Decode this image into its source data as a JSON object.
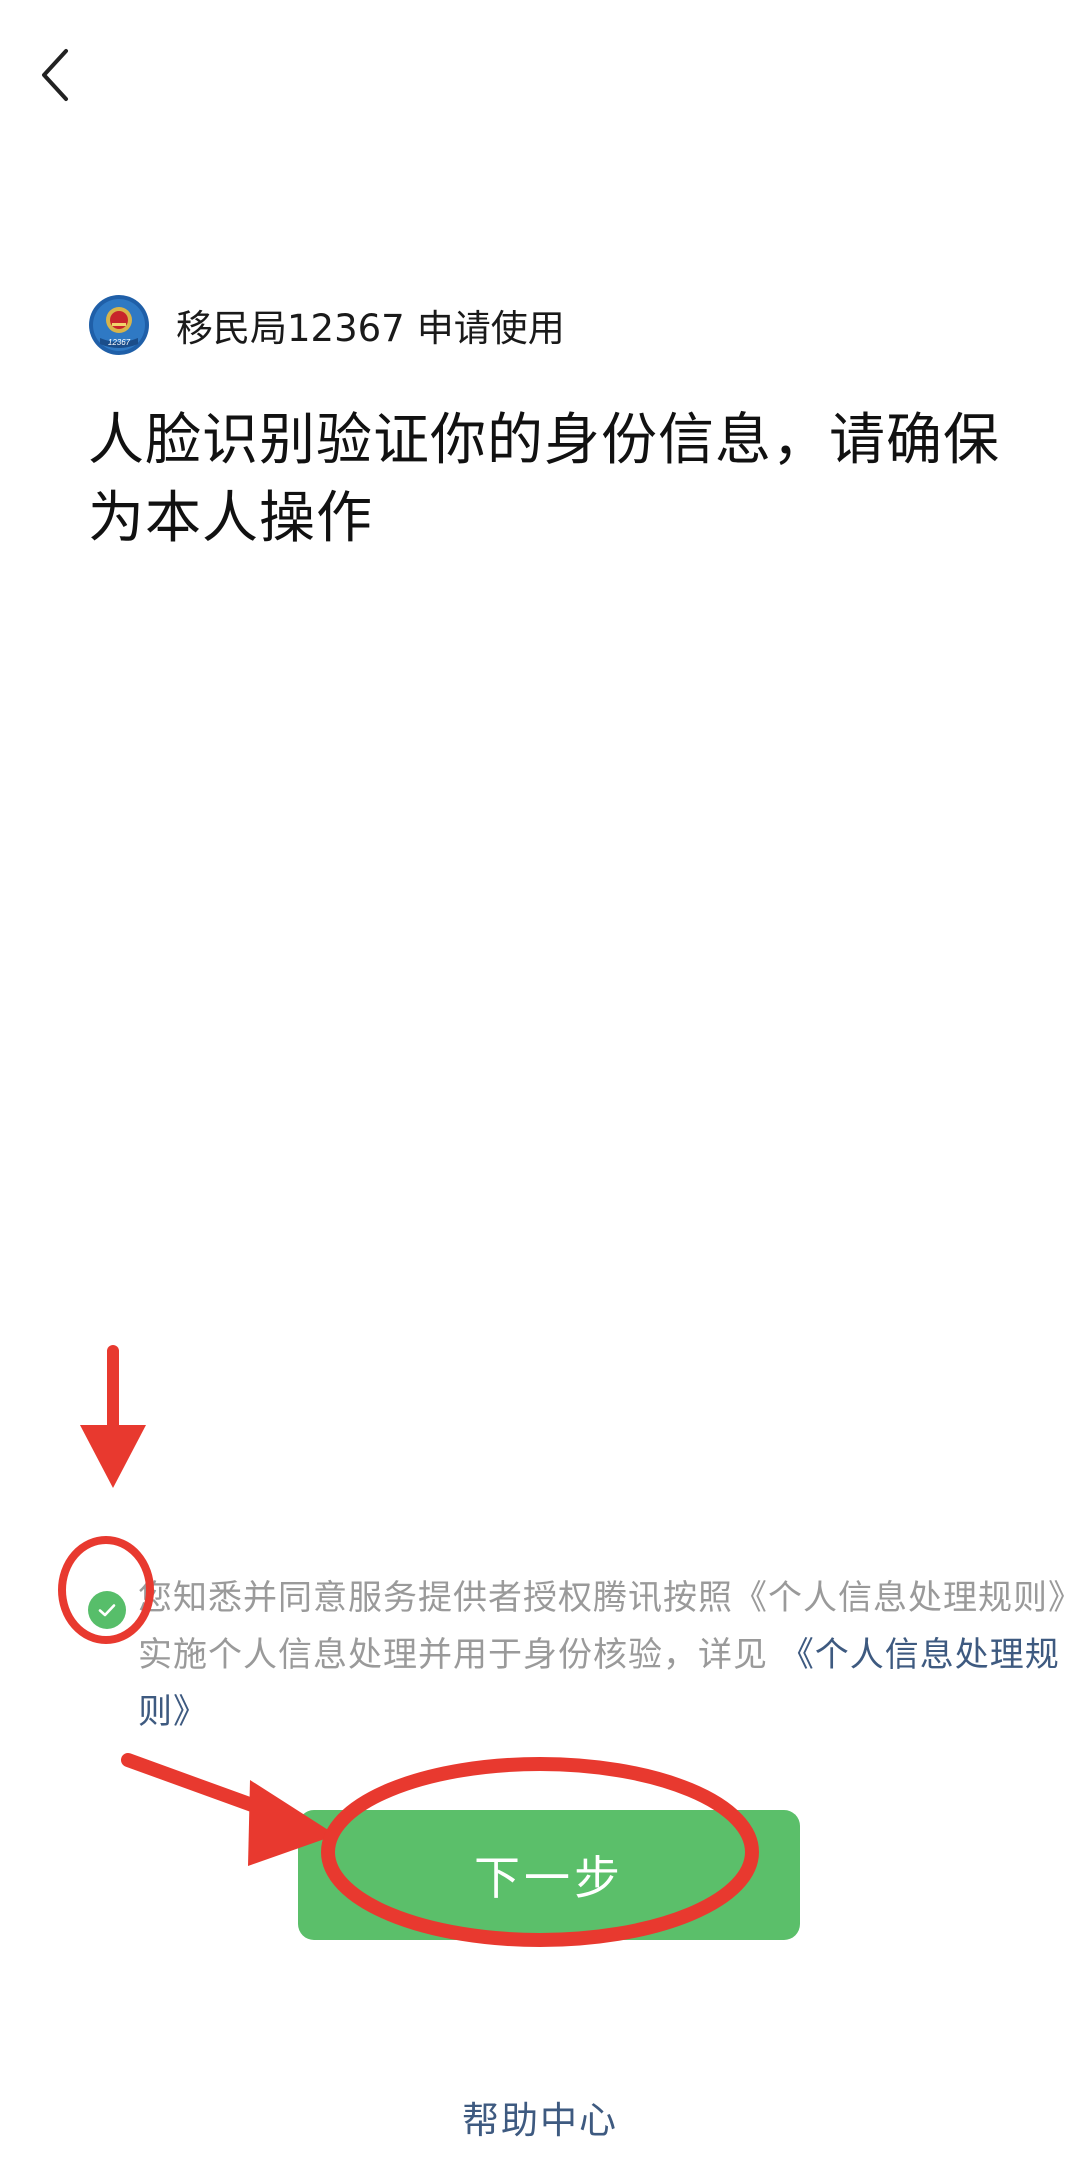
{
  "nav": {
    "back_icon": "chevron-left-icon"
  },
  "app": {
    "name": "移民局12367",
    "request_text": "申请使用",
    "logo_icon": "immigration-emblem-icon",
    "logo_text": "12367"
  },
  "headline": "人脸识别验证你的身份信息，请确保为本人操作",
  "consent": {
    "checked": true,
    "check_icon": "check-circle-icon",
    "text": "您知悉并同意服务提供者授权腾讯按照《个人信息处理规则》实施个人信息处理并用于身份核验，详见",
    "link_text": "《个人信息处理规则》"
  },
  "next_button": {
    "label": "下一步"
  },
  "help": {
    "label": "帮助中心"
  },
  "colors": {
    "accent_green": "#5bbf6a",
    "link_blue": "#3e5a80",
    "annotation_red": "#e8392f",
    "muted_text": "#9a9a9a"
  }
}
